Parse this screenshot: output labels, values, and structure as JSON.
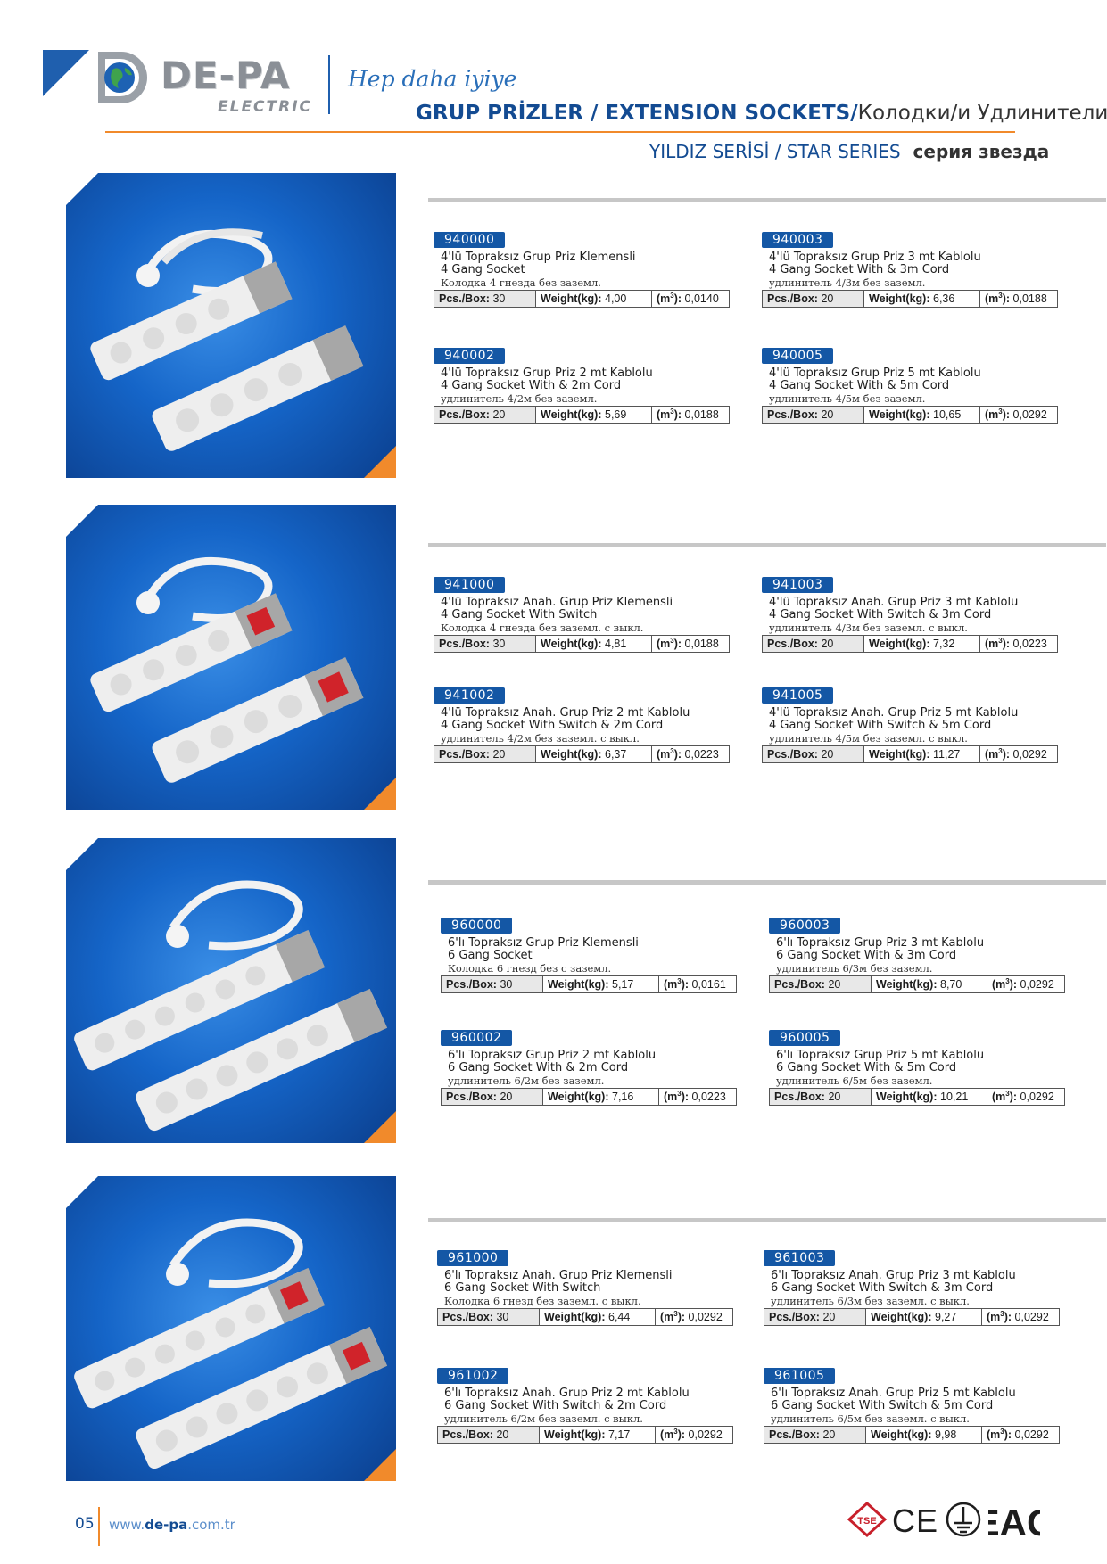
{
  "header": {
    "brand": "DE-PA",
    "brand_sub": "ELECTRIC",
    "slogan": "Hep daha iyiye",
    "title_main": "GRUP PRİZLER / EXTENSION SOCKETS/",
    "title_ru": "Колодки/и Удлинители",
    "series_main": "YILDIZ SERİSİ / STAR SERIES",
    "series_ru": "серия звезда"
  },
  "labels": {
    "pcs_box": "Pcs./Box:",
    "weight": "Weight(kg):",
    "m3": "(m",
    "m3_sup": "3",
    "m3_close": "):"
  },
  "products": [
    {
      "items": [
        {
          "code": "940000",
          "line1": "4'lü Topraksız Grup Priz Klemensli",
          "line2": "4 Gang Socket",
          "line3": "Колодка 4 гнезда без заземл.",
          "pcs": "30",
          "weight": "4,00",
          "m3": "0,0140"
        },
        {
          "code": "940003",
          "line1": "4'lü Topraksız Grup Priz 3 mt Kablolu",
          "line2": "4 Gang Socket With & 3m Cord",
          "line3": "удлинитель 4/3м без заземл.",
          "pcs": "20",
          "weight": "6,36",
          "m3": "0,0188"
        },
        {
          "code": "940002",
          "line1": "4'lü Topraksız Grup Priz 2 mt Kablolu",
          "line2": "4 Gang Socket With & 2m Cord",
          "line3": "удлинитель 4/2м без заземл.",
          "pcs": "20",
          "weight": "5,69",
          "m3": "0,0188"
        },
        {
          "code": "940005",
          "line1": "4'lü Topraksız Grup Priz 5 mt Kablolu",
          "line2": "4 Gang Socket With & 5m Cord",
          "line3": "удлинитель 4/5м без заземл.",
          "pcs": "20",
          "weight": "10,65",
          "m3": "0,0292"
        }
      ]
    },
    {
      "items": [
        {
          "code": "941000",
          "line1": "4'lü Topraksız Anah. Grup Priz Klemensli",
          "line2": "4 Gang Socket With Switch",
          "line3": "Колодка 4 гнезда без заземл. с выкл.",
          "pcs": "30",
          "weight": "4,81",
          "m3": "0,0188"
        },
        {
          "code": "941003",
          "line1": "4'lü Topraksız Anah. Grup Priz 3 mt Kablolu",
          "line2": "4 Gang Socket With Switch & 3m Cord",
          "line3": "удлинитель 4/3м без заземл. с выкл.",
          "pcs": "20",
          "weight": "7,32",
          "m3": "0,0223"
        },
        {
          "code": "941002",
          "line1": "4'lü Topraksız Anah. Grup Priz 2 mt Kablolu",
          "line2": "4 Gang Socket With Switch & 2m Cord",
          "line3": "удлинитель 4/2м без заземл. с выкл.",
          "pcs": "20",
          "weight": "6,37",
          "m3": "0,0223"
        },
        {
          "code": "941005",
          "line1": "4'lü Topraksız Anah. Grup Priz 5 mt Kablolu",
          "line2": "4 Gang Socket With Switch & 5m Cord",
          "line3": "удлинитель 4/5м без заземл. с выкл.",
          "pcs": "20",
          "weight": "11,27",
          "m3": "0,0292"
        }
      ]
    },
    {
      "items": [
        {
          "code": "960000",
          "line1": "6'lı Topraksız Grup Priz Klemensli",
          "line2": "6 Gang Socket",
          "line3": "Колодка 6 гнезд без с заземл.",
          "pcs": "30",
          "weight": "5,17",
          "m3": "0,0161"
        },
        {
          "code": "960003",
          "line1": "6'lı Topraksız Grup Priz 3 mt Kablolu",
          "line2": "6 Gang Socket With & 3m Cord",
          "line3": "удлинитель 6/3м без заземл.",
          "pcs": "20",
          "weight": "8,70",
          "m3": "0,0292"
        },
        {
          "code": "960002",
          "line1": "6'lı Topraksız Grup Priz 2 mt Kablolu",
          "line2": "6 Gang Socket With & 2m Cord",
          "line3": "удлинитель 6/2м без заземл.",
          "pcs": "20",
          "weight": "7,16",
          "m3": "0,0223"
        },
        {
          "code": "960005",
          "line1": "6'lı Topraksız Grup Priz 5 mt Kablolu",
          "line2": "6 Gang Socket With & 5m Cord",
          "line3": "удлинитель 6/5м без заземл.",
          "pcs": "20",
          "weight": "10,21",
          "m3": "0,0292"
        }
      ]
    },
    {
      "items": [
        {
          "code": "961000",
          "line1": "6'lı Topraksız Anah. Grup Priz Klemensli",
          "line2": "6 Gang Socket With Switch",
          "line3": "Колодка 6 гнезд без заземл. с выкл.",
          "pcs": "30",
          "weight": "6,44",
          "m3": "0,0292"
        },
        {
          "code": "961003",
          "line1": "6'lı Topraksız Anah. Grup Priz 3 mt Kablolu",
          "line2": "6 Gang Socket With Switch & 3m Cord",
          "line3": "удлинитель 6/3м без заземл. с выкл.",
          "pcs": "20",
          "weight": "9,27",
          "m3": "0,0292"
        },
        {
          "code": "961002",
          "line1": "6'lı Topraksız Anah. Grup Priz 2 mt Kablolu",
          "line2": "6 Gang Socket With Switch & 2m Cord",
          "line3": "удлинитель 6/2м без заземл. с выкл.",
          "pcs": "20",
          "weight": "7,17",
          "m3": "0,0292"
        },
        {
          "code": "961005",
          "line1": "6'lı Topraksız Anah. Grup Priz 5 mt Kablolu",
          "line2": "6 Gang Socket With Switch & 5m Cord",
          "line3": "удлинитель 6/5м без заземл. с выкл.",
          "pcs": "20",
          "weight": "9,98",
          "m3": "0,0292"
        }
      ]
    }
  ],
  "footer": {
    "page_number": "05",
    "web_prefix": "www.",
    "web_bold": "de-pa",
    "web_suffix": ".com.tr",
    "cert_tse": "TSE",
    "cert_ce": "CE",
    "cert_eac": "EAC"
  },
  "colors": {
    "brand_blue": "#134b92",
    "code_blue": "#1457a5",
    "accent_orange": "#f18a2b",
    "panel_blue": "#1565c8"
  }
}
